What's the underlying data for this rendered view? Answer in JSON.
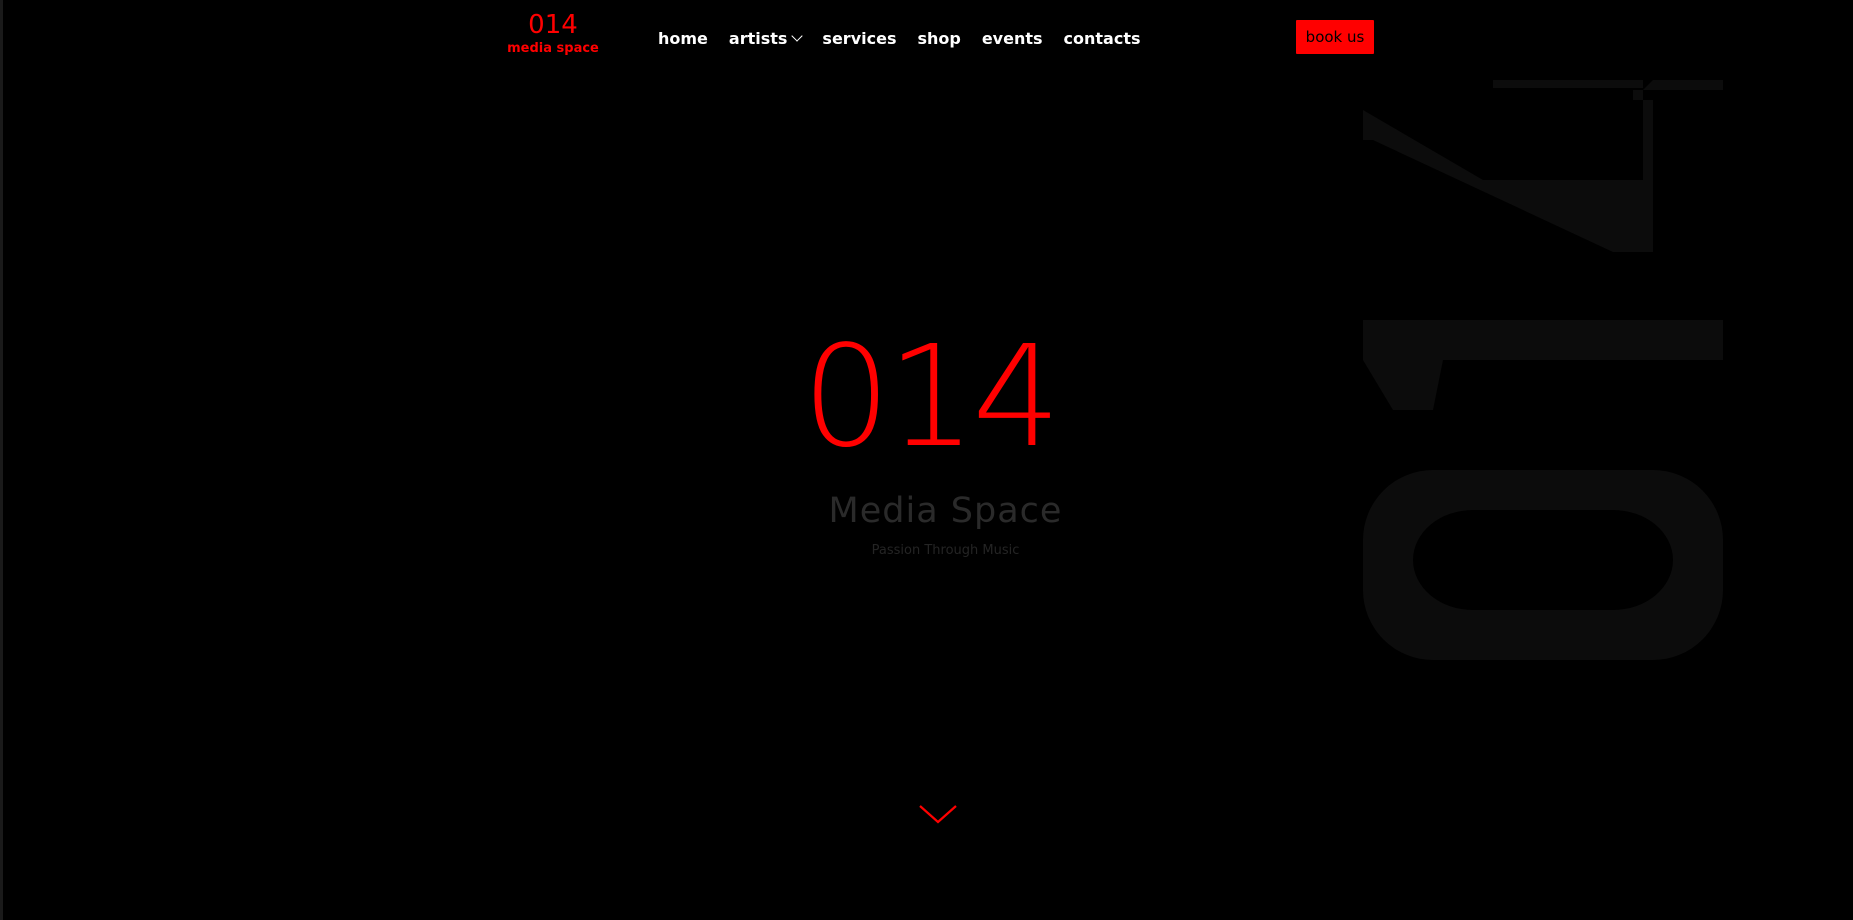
{
  "logo": {
    "number": "014",
    "text": "media space"
  },
  "nav": {
    "items": [
      {
        "label": "home"
      },
      {
        "label": "artists",
        "has_dropdown": true
      },
      {
        "label": "services"
      },
      {
        "label": "shop"
      },
      {
        "label": "events"
      },
      {
        "label": "contacts"
      }
    ]
  },
  "cta": {
    "label": "book us"
  },
  "hero": {
    "number": "014",
    "title": "Media Space",
    "subtitle": "Passion Through Music"
  },
  "icons": {
    "nav_dropdown": "chevron-down-icon",
    "scroll": "chevron-down-icon",
    "background": "watermark-icon"
  },
  "colors": {
    "background": "#000000",
    "accent": "#ff0000",
    "nav_text": "#ffffff",
    "muted_text": "#2a2a2a",
    "watermark": "#0c0c0c"
  }
}
